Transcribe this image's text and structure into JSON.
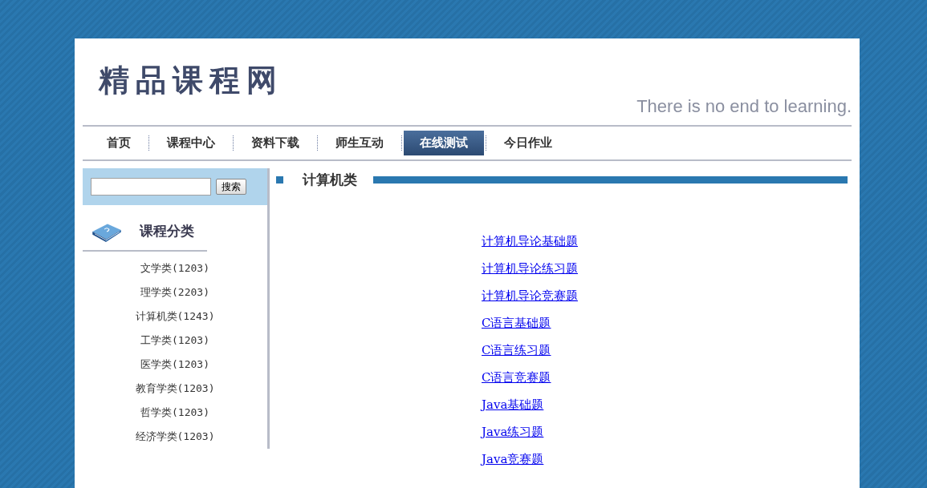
{
  "header": {
    "logo": "精品课程网",
    "tagline": "There is no end to learning."
  },
  "nav": [
    {
      "label": "首页",
      "selected": false
    },
    {
      "label": "课程中心",
      "selected": false
    },
    {
      "label": "资料下载",
      "selected": false
    },
    {
      "label": "师生互动",
      "selected": false
    },
    {
      "label": "在线测试",
      "selected": true
    },
    {
      "label": "今日作业",
      "selected": false
    }
  ],
  "search": {
    "button": "搜索"
  },
  "sidebar": {
    "title": "课程分类",
    "items": [
      {
        "name": "文学类",
        "count": "(1203)"
      },
      {
        "name": "理学类",
        "count": "(2203)"
      },
      {
        "name": "计算机类",
        "count": "(1243)"
      },
      {
        "name": "工学类",
        "count": "(1203)"
      },
      {
        "name": "医学类",
        "count": "(1203)"
      },
      {
        "name": "教育学类",
        "count": "(1203)"
      },
      {
        "name": "哲学类",
        "count": "(1203)"
      },
      {
        "name": "经济学类",
        "count": "(1203)"
      }
    ]
  },
  "main": {
    "title": "计算机类",
    "links": [
      "计算机导论基础题",
      "计算机导论练习题",
      "计算机导论竞赛题",
      "C语言基础题",
      "C语言练习题",
      "C语言竞赛题",
      "Java基础题",
      "Java练习题",
      "Java竞赛题"
    ]
  }
}
